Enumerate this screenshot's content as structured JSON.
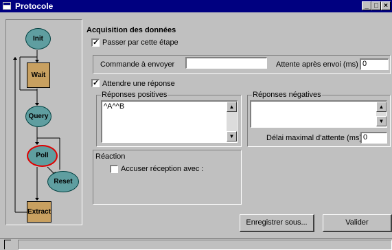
{
  "window": {
    "title": "Protocole",
    "buttons": {
      "minimize": "_",
      "maximize": "□",
      "close": "×"
    }
  },
  "flowchart": {
    "nodes": [
      "Init",
      "Wait",
      "Query",
      "Poll",
      "Reset",
      "Extract"
    ],
    "colors": {
      "oval": "#5f9ea0",
      "rect": "#c8a060",
      "active_border": "#e00000"
    }
  },
  "acquisition": {
    "heading": "Acquisition des données",
    "skip_step": {
      "label": "Passer par cette étape",
      "checked": true
    },
    "command": {
      "label": "Commande à envoyer",
      "value": ""
    },
    "wait_after_send": {
      "label": "Attente après envoi (ms)",
      "value": "0"
    },
    "await_response": {
      "label": "Attendre une réponse",
      "checked": true
    },
    "positive": {
      "title": "Réponses positives",
      "value": "^A^^B"
    },
    "negative": {
      "title": "Réponses négatives",
      "value": ""
    },
    "max_delay": {
      "label": "Délai maximal d'attente (ms)",
      "value": "0"
    },
    "reaction": {
      "title": "Réaction",
      "acknowledge": {
        "label": "Accuser réception avec :",
        "checked": false
      }
    }
  },
  "actions": {
    "save_as": "Enregistrer sous...",
    "validate": "Valider"
  }
}
